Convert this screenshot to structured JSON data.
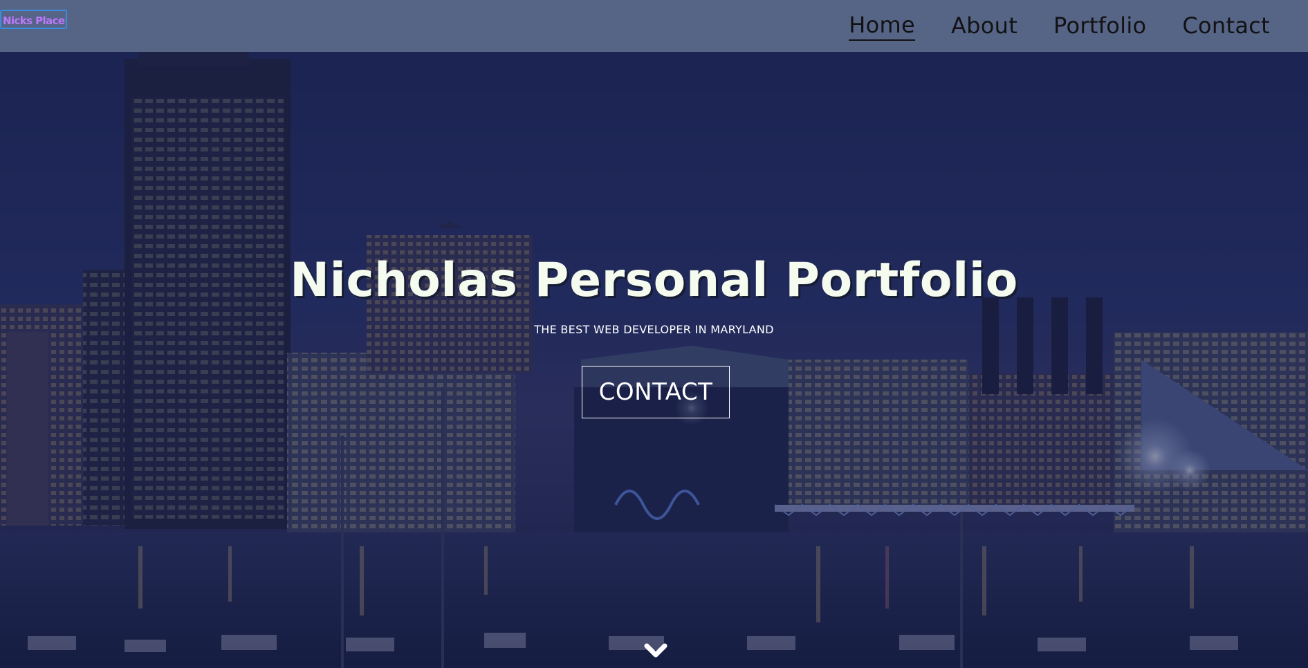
{
  "page": {
    "title": "Nicholas Personal Portfolio"
  },
  "navbar": {
    "logo_text": "Nicks Place",
    "links": [
      {
        "label": "Home",
        "active": true
      },
      {
        "label": "About",
        "active": false
      },
      {
        "label": "Portfolio",
        "active": false
      },
      {
        "label": "Contact",
        "active": false
      }
    ]
  },
  "hero": {
    "title": "Nicholas Personal Portfolio",
    "subtitle": "THE BEST WEB DEVELOPER IN MARYLAND",
    "cta_label": "CONTACT",
    "background_image": "night-city-skyline-harbor",
    "scroll_icon": "chevron-down-icon"
  },
  "colors": {
    "navbar_bg": "#566586",
    "nav_text": "#121214",
    "logo_text": "#b77cf0",
    "logo_border": "#3a8de0",
    "hero_overlay": "#182050",
    "hero_text": "#f5fbee"
  }
}
